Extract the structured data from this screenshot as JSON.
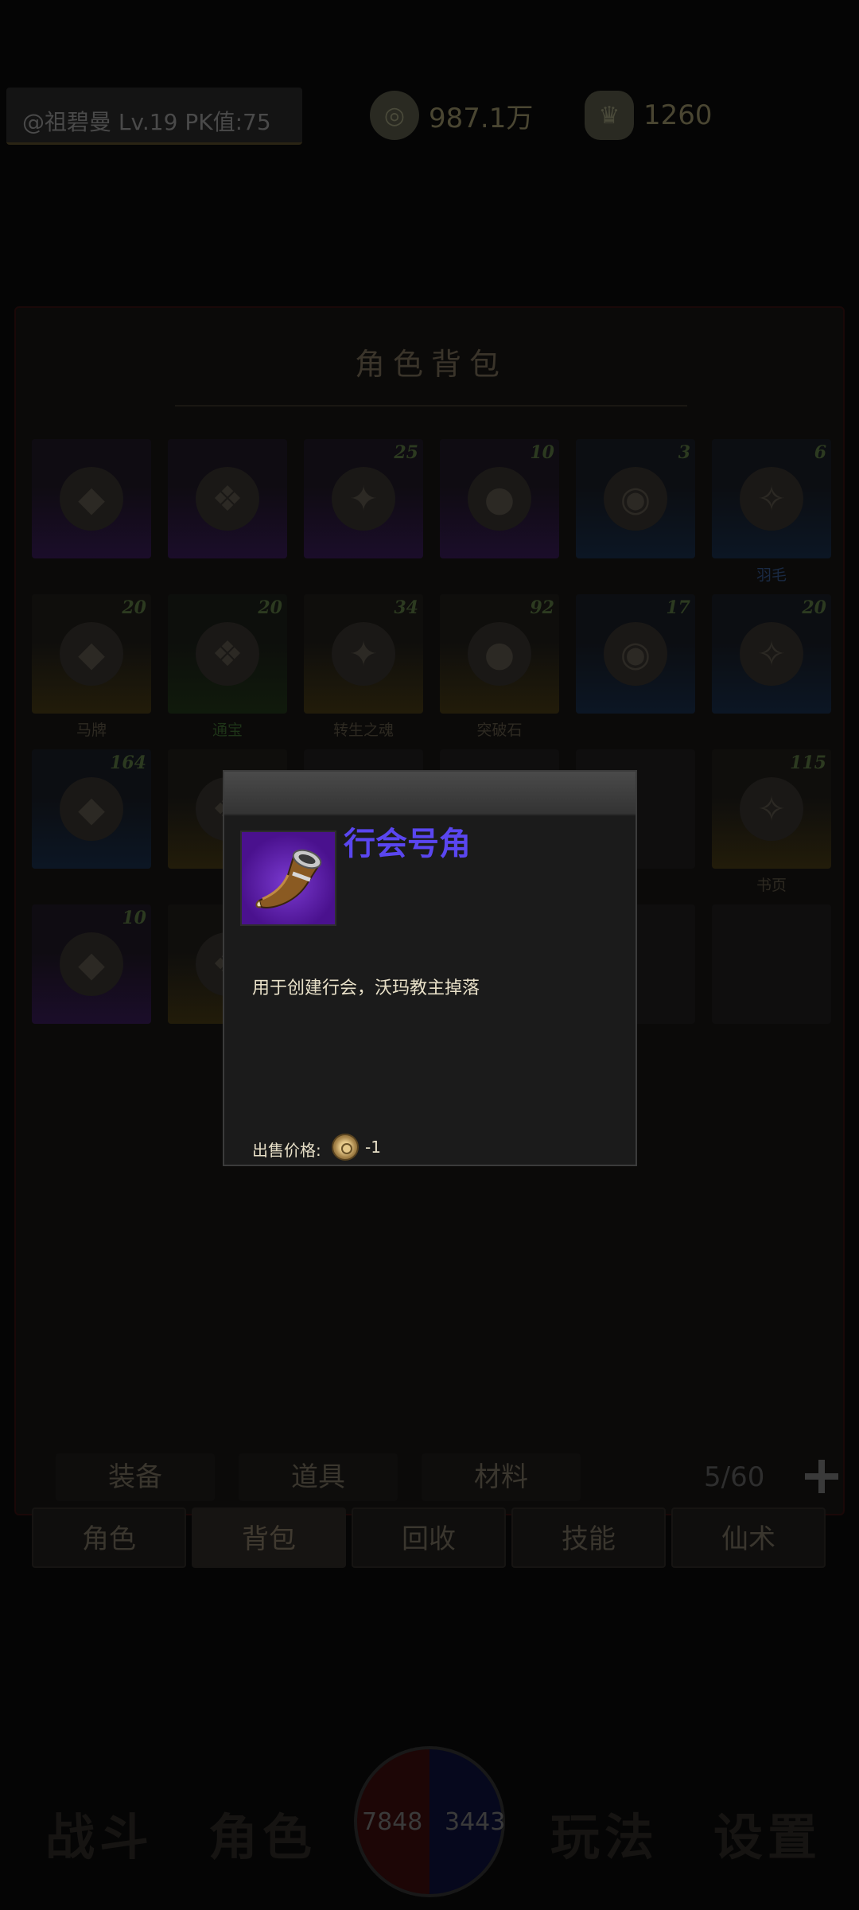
{
  "topbar": {
    "player": "@祖碧曼  Lv.19 PK值:75",
    "gold": "987.1万",
    "ingot": "1260"
  },
  "panel": {
    "title": "角色背包"
  },
  "inventory": [
    {
      "count": "",
      "name": "",
      "quality": "purple"
    },
    {
      "count": "",
      "name": "",
      "quality": "purple"
    },
    {
      "count": "25",
      "name": "",
      "quality": "purple"
    },
    {
      "count": "10",
      "name": "",
      "quality": "purple"
    },
    {
      "count": "3",
      "name": "",
      "quality": "blue"
    },
    {
      "count": "6",
      "name": "羽毛",
      "quality": "blue"
    },
    {
      "count": "20",
      "name": "马牌",
      "quality": "gold"
    },
    {
      "count": "20",
      "name": "通宝",
      "quality": "green"
    },
    {
      "count": "34",
      "name": "转生之魂",
      "quality": "gold"
    },
    {
      "count": "92",
      "name": "突破石",
      "quality": "gold"
    },
    {
      "count": "17",
      "name": "",
      "quality": "blue"
    },
    {
      "count": "20",
      "name": "",
      "quality": "blue"
    },
    {
      "count": "164",
      "name": "",
      "quality": "blue"
    },
    {
      "count": "",
      "name": "",
      "quality": "gold"
    },
    {
      "count": "",
      "name": "",
      "quality": "none"
    },
    {
      "count": "",
      "name": "",
      "quality": "none"
    },
    {
      "count": "",
      "name": "",
      "quality": "none"
    },
    {
      "count": "115",
      "name": "书页",
      "quality": "gold"
    },
    {
      "count": "10",
      "name": "",
      "quality": "purple"
    },
    {
      "count": "",
      "name": "",
      "quality": "gold"
    },
    {
      "count": "",
      "name": "",
      "quality": "none"
    },
    {
      "count": "",
      "name": "",
      "quality": "none"
    },
    {
      "count": "",
      "name": "",
      "quality": "none"
    },
    {
      "count": "",
      "name": "",
      "quality": "none"
    }
  ],
  "subtabs": {
    "equipment": "装备",
    "items": "道具",
    "materials": "材料",
    "capacity": "5/60"
  },
  "roletabs": [
    "角色",
    "背包",
    "回收",
    "技能",
    "仙术"
  ],
  "nav": {
    "battle": "战斗",
    "character": "角色",
    "hp": "7848",
    "mp": "3443",
    "gameplay": "玩法",
    "settings": "设置"
  },
  "tooltip": {
    "item_name": "行会号角",
    "description": "用于创建行会，沃玛教主掉落",
    "price_label": "出售价格:",
    "price_value": "-1",
    "name_color": "#5a46f0",
    "frame_color": "#4a118e"
  }
}
